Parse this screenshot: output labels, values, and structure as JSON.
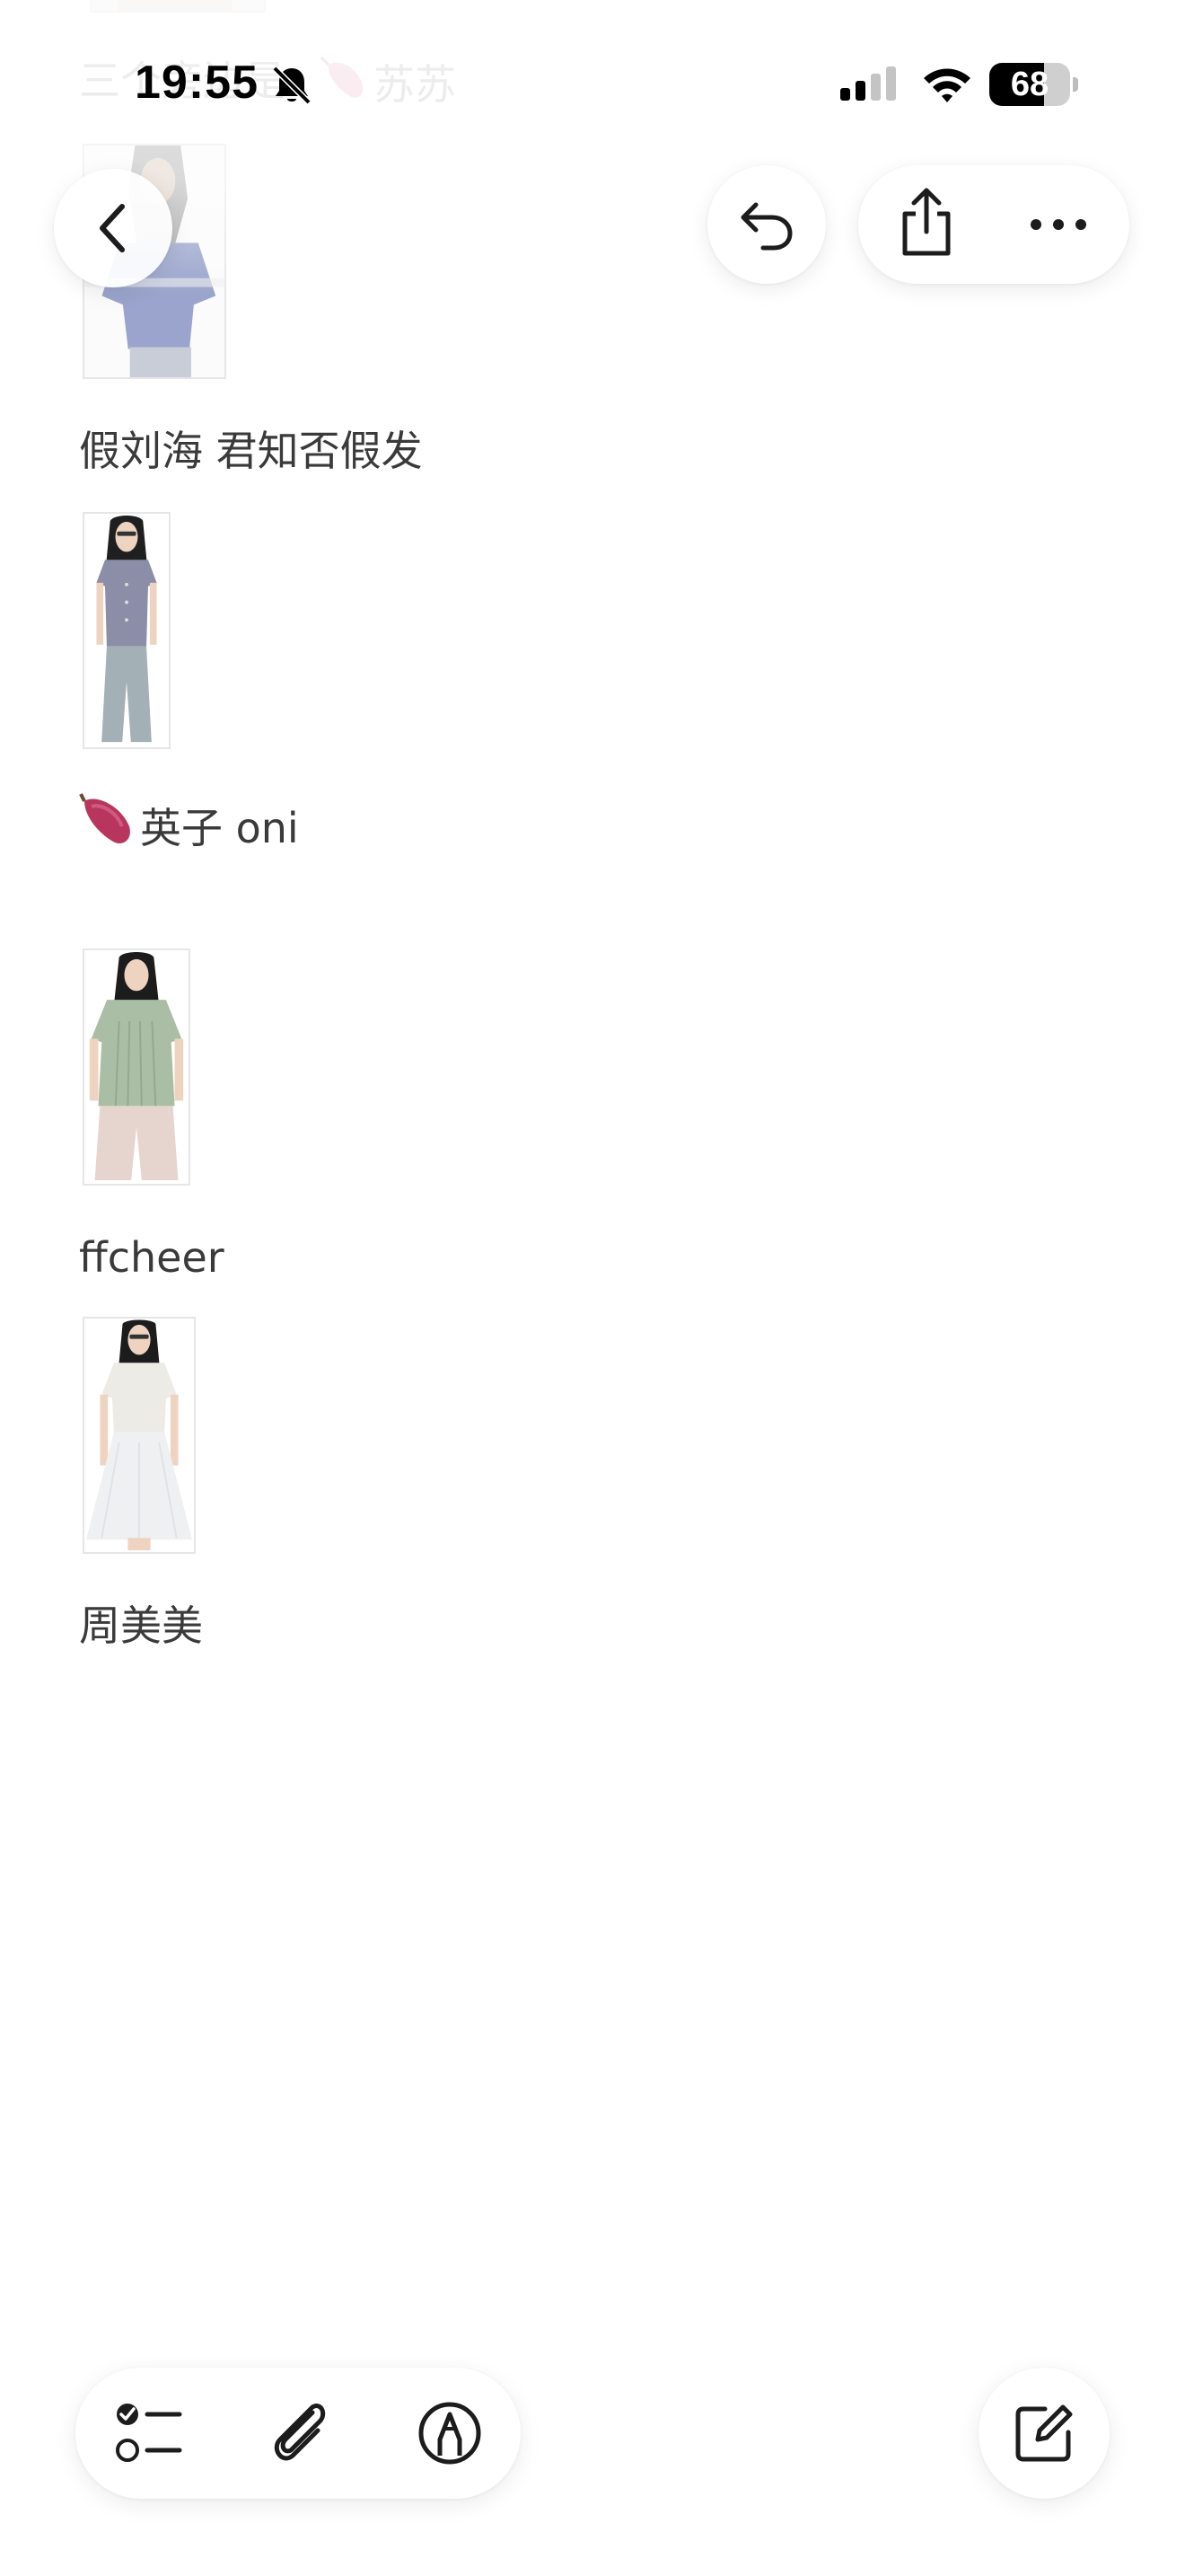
{
  "status_bar": {
    "time": "19:55",
    "battery_percent": "68",
    "icons": [
      "bell-slash-icon",
      "cellular-signal-icon",
      "wifi-icon",
      "battery-icon"
    ]
  },
  "note": {
    "lines": [
      {
        "text": "三个旁边是",
        "style": "faded"
      },
      {
        "emoji": "sweet-potato-emoji",
        "text": "苏苏",
        "style": "faded"
      },
      {
        "text": "假刘海 君知否假发"
      },
      {
        "emoji": "sweet-potato-emoji",
        "text": "英子 oni"
      },
      {
        "text": "ffcheer"
      },
      {
        "text": "周美美"
      }
    ],
    "photos": [
      {
        "subject": "woman in blue-gray t-shirt, cropped at top"
      },
      {
        "subject": "woman in gray button blouse and wide jeans"
      },
      {
        "subject": "woman in sage green pleated top and pink pants"
      },
      {
        "subject": "woman in white lace blouse and white skirt"
      }
    ]
  },
  "nav": {
    "back_icon": "chevron-left-icon",
    "undo_icon": "undo-arrow-icon",
    "share_icon": "share-icon",
    "more_icon": "ellipsis-icon"
  },
  "toolbar": {
    "checklist_icon": "checklist-icon",
    "attach_icon": "paperclip-icon",
    "markup_icon": "markup-pen-icon",
    "compose_icon": "compose-icon"
  },
  "colors": {
    "text": "#3a3a3a",
    "faded_text": "#c9c9c9",
    "icon": "#1c1c1c",
    "background": "#ffffff"
  }
}
